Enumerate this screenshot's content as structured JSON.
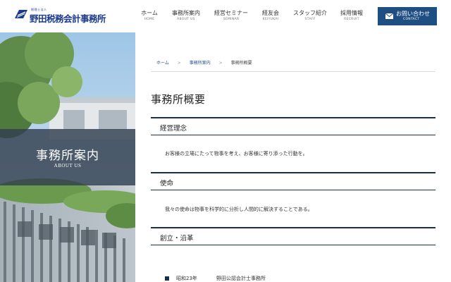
{
  "header": {
    "logo": {
      "small_text": "税理士法人",
      "main_text": "野田税務会計事務所"
    },
    "nav": [
      {
        "ja": "ホーム",
        "en": "HOME"
      },
      {
        "ja": "事務所案内",
        "en": "ABOUT US"
      },
      {
        "ja": "経営セミナー",
        "en": "SEMINAR"
      },
      {
        "ja": "経友会",
        "en": "KEIYUKAI"
      },
      {
        "ja": "スタッフ紹介",
        "en": "STAFF"
      },
      {
        "ja": "採用情報",
        "en": "RECRUIT"
      }
    ],
    "contact": {
      "ja": "お問い合わせ",
      "en": "CONTACT",
      "icon": "mail-icon"
    }
  },
  "hero": {
    "title": "事務所案内",
    "subtitle": "ABOUT US",
    "overlay_color": "#323e4e"
  },
  "breadcrumb": [
    "ホーム",
    "事務所案内",
    "事務所概要"
  ],
  "page_title": "事務所概要",
  "sections": [
    {
      "heading": "経営理念",
      "text": "お客様の立場にたって物事を考え、お客様に寄り添った行動を。"
    },
    {
      "heading": "使命",
      "text": "我々の使命は物事を科学的に分析し人間的に解決することである。"
    },
    {
      "heading": "創立・沿革",
      "text": ""
    }
  ],
  "history": [
    {
      "year": "昭和23年",
      "event": "野田公認会計士事務所"
    }
  ],
  "colors": {
    "accent": "#1f4e82",
    "rule": "#1b2e4a",
    "logo": "#1b3a8c"
  }
}
